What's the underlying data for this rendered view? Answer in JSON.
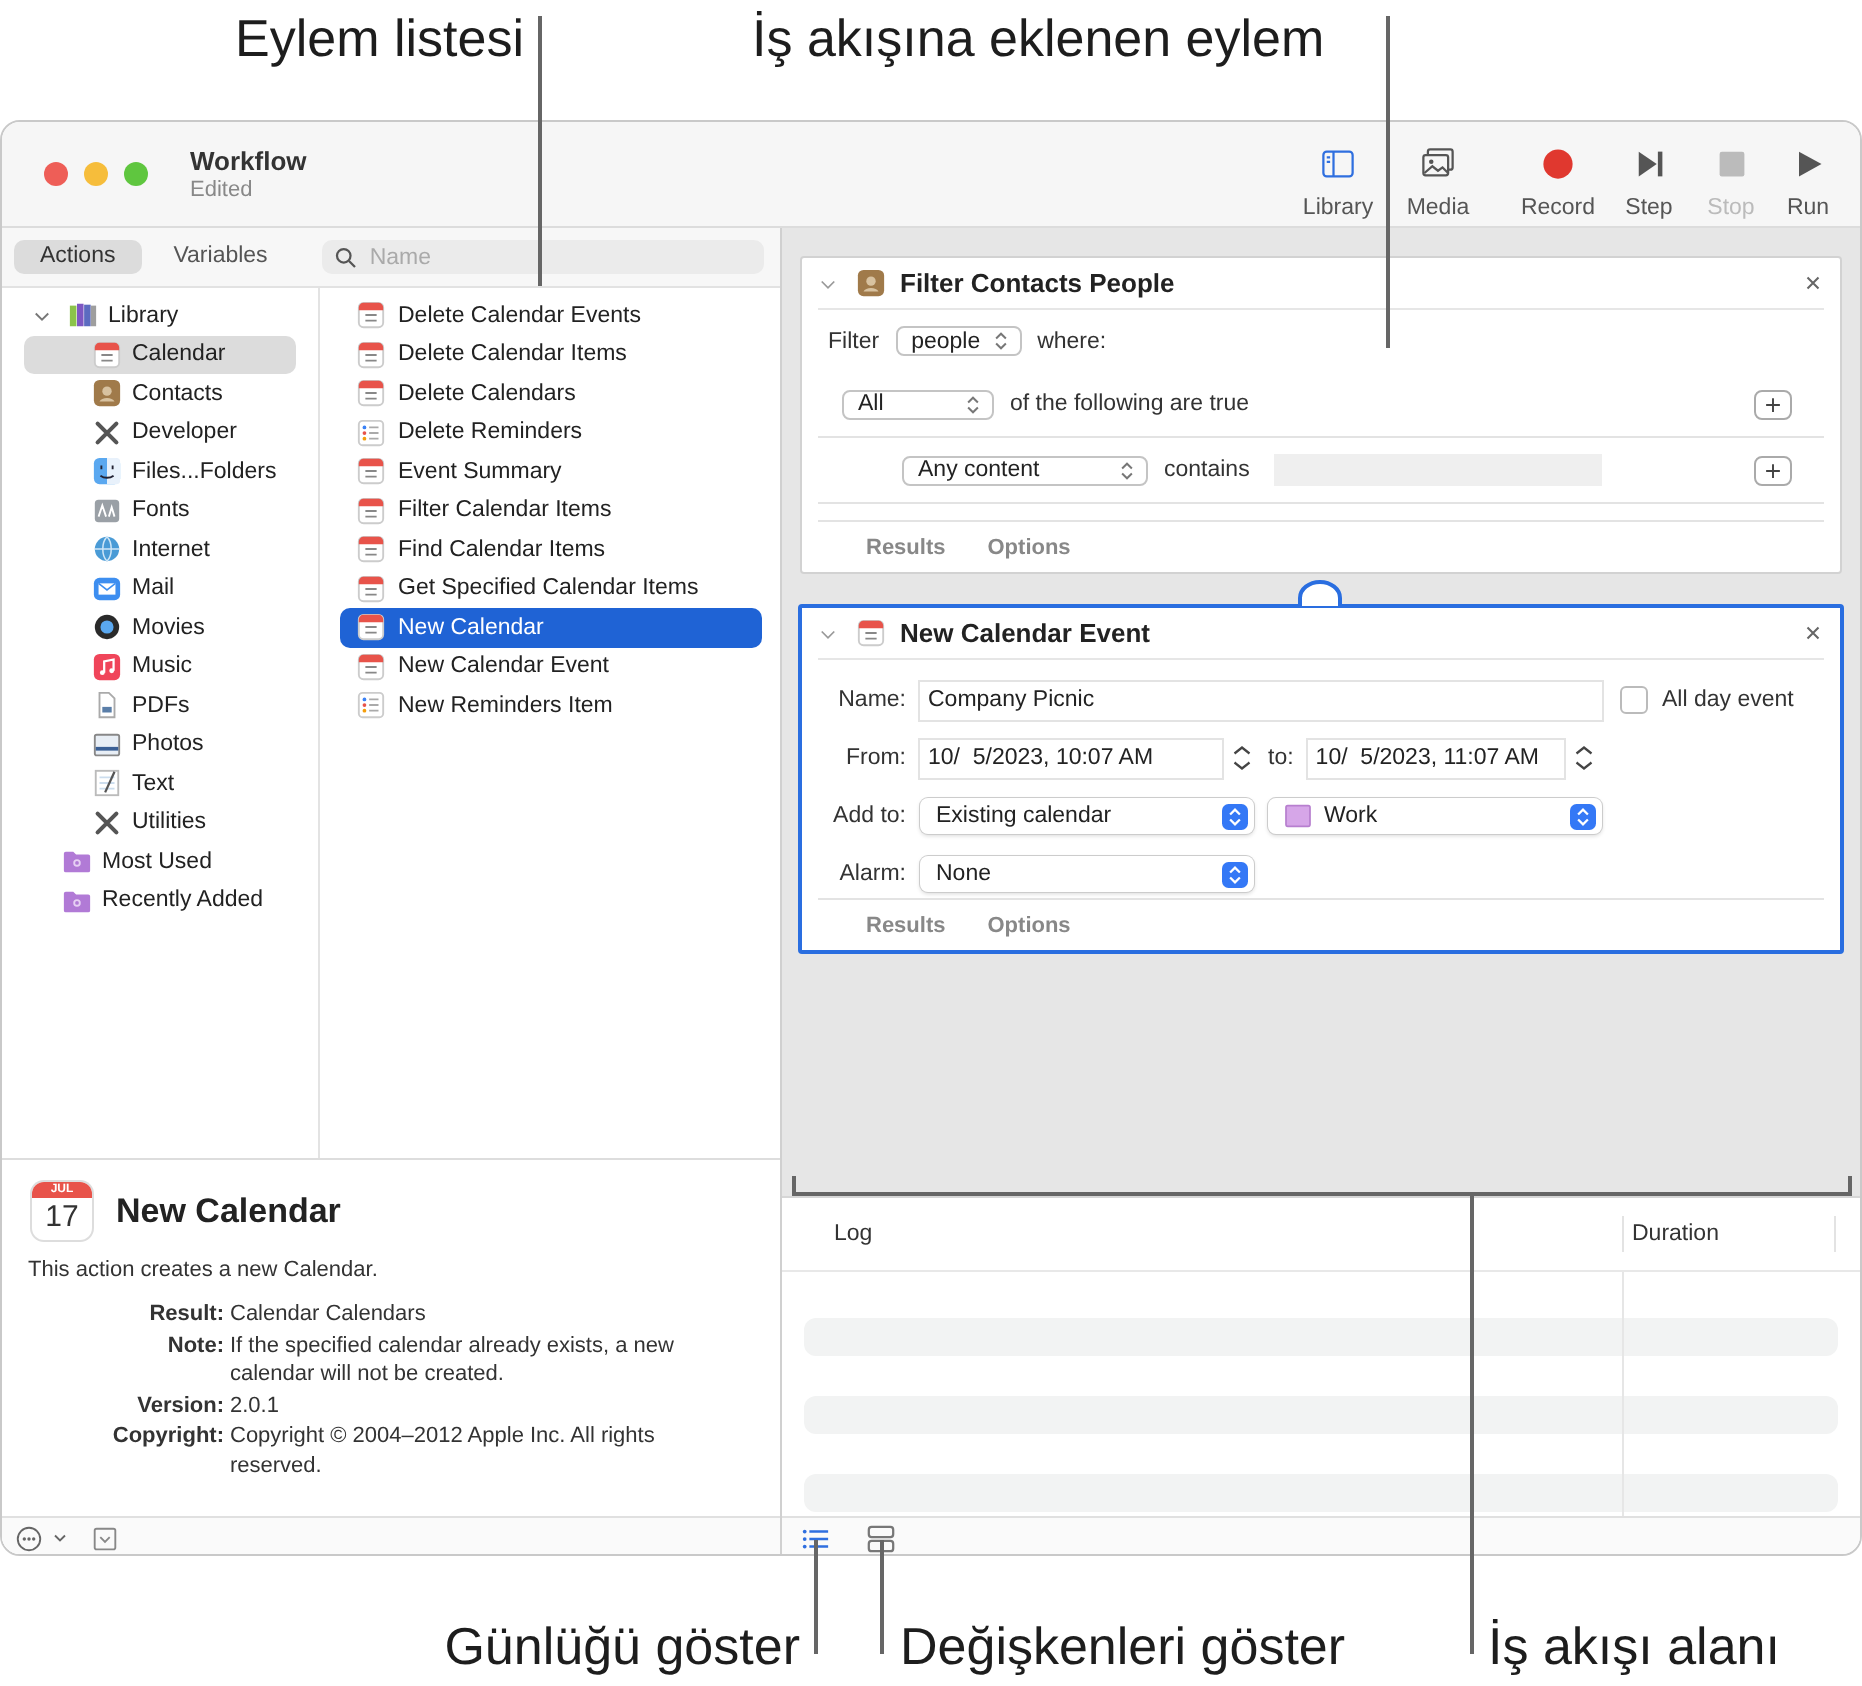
{
  "callouts": [
    {
      "text": "Eylem listesi"
    },
    {
      "text": "İş akışına eklenen eylem"
    },
    {
      "text": "Günlüğü göster"
    },
    {
      "text": "Değişkenleri göster"
    },
    {
      "text": "İş akışı alanı"
    }
  ],
  "window": {
    "title": "Workflow",
    "subtitle": "Edited"
  },
  "toolbar": [
    {
      "label": "Library",
      "kind": "library",
      "on": true,
      "disabled": false
    },
    {
      "label": "Media",
      "kind": "media",
      "on": false,
      "disabled": false
    },
    {
      "label": "Record",
      "kind": "record",
      "on": false,
      "disabled": false
    },
    {
      "label": "Step",
      "kind": "step",
      "on": false,
      "disabled": false
    },
    {
      "label": "Stop",
      "kind": "stop",
      "on": false,
      "disabled": true
    },
    {
      "label": "Run",
      "kind": "run",
      "on": false,
      "disabled": false
    }
  ],
  "library_tabs": [
    {
      "label": "Actions",
      "selected": true
    },
    {
      "label": "Variables",
      "selected": false
    }
  ],
  "search": {
    "placeholder": "Name"
  },
  "library_tree": [
    {
      "label": "Library",
      "kind": "library",
      "expanded": true,
      "selected": false,
      "children": [
        {
          "label": "Calendar",
          "kind": "calendar",
          "selected": true
        },
        {
          "label": "Contacts",
          "kind": "contacts",
          "selected": false
        },
        {
          "label": "Developer",
          "kind": "tools",
          "selected": false
        },
        {
          "label": "Files...Folders",
          "kind": "finder",
          "selected": false
        },
        {
          "label": "Fonts",
          "kind": "fonts",
          "selected": false
        },
        {
          "label": "Internet",
          "kind": "internet",
          "selected": false
        },
        {
          "label": "Mail",
          "kind": "mail",
          "selected": false
        },
        {
          "label": "Movies",
          "kind": "movies",
          "selected": false
        },
        {
          "label": "Music",
          "kind": "music",
          "selected": false
        },
        {
          "label": "PDFs",
          "kind": "pdfs",
          "selected": false
        },
        {
          "label": "Photos",
          "kind": "photos",
          "selected": false
        },
        {
          "label": "Text",
          "kind": "text",
          "selected": false
        },
        {
          "label": "Utilities",
          "kind": "tools",
          "selected": false
        }
      ]
    },
    {
      "label": "Most Used",
      "kind": "smart",
      "selected": false
    },
    {
      "label": "Recently Added",
      "kind": "smart",
      "selected": false
    }
  ],
  "actions": [
    {
      "label": "Delete Calendar Events",
      "kind": "calendar",
      "selected": false
    },
    {
      "label": "Delete Calendar Items",
      "kind": "calendar",
      "selected": false
    },
    {
      "label": "Delete Calendars",
      "kind": "calendar",
      "selected": false
    },
    {
      "label": "Delete Reminders",
      "kind": "reminders",
      "selected": false
    },
    {
      "label": "Event Summary",
      "kind": "calendar",
      "selected": false
    },
    {
      "label": "Filter Calendar Items",
      "kind": "calendar",
      "selected": false
    },
    {
      "label": "Find Calendar Items",
      "kind": "calendar",
      "selected": false
    },
    {
      "label": "Get Specified Calendar Items",
      "kind": "calendar",
      "selected": false
    },
    {
      "label": "New Calendar",
      "kind": "calendar",
      "selected": true
    },
    {
      "label": "New Calendar Event",
      "kind": "calendar",
      "selected": false
    },
    {
      "label": "New Reminders Item",
      "kind": "reminders",
      "selected": false
    }
  ],
  "description": {
    "title": "New Calendar",
    "icon_month": "JUL",
    "icon_day": "17",
    "summary": "This action creates a new Calendar.",
    "fields": [
      {
        "label": "Result:",
        "value": "Calendar Calendars"
      },
      {
        "label": "Note:",
        "value": "If the specified calendar already exists, a new calendar will not be created."
      },
      {
        "label": "Version:",
        "value": "2.0.1"
      },
      {
        "label": "Copyright:",
        "value": "Copyright © 2004–2012 Apple Inc.  All rights reserved."
      }
    ]
  },
  "workflow": {
    "actions": [
      {
        "kind": "filter",
        "title": "Filter Contacts People",
        "selected": false,
        "filter_label": "Filter",
        "filter_value": "people",
        "where": "where:",
        "match_value": "All",
        "match_text": "of the following are true",
        "condition_field": "Any content",
        "condition_op": "contains",
        "tabs": [
          "Results",
          "Options"
        ]
      },
      {
        "kind": "event",
        "title": "New Calendar Event",
        "selected": true,
        "name_label": "Name:",
        "name_value": "Company Picnic",
        "all_day_label": "All day event",
        "all_day": false,
        "from_label": "From:",
        "from_value": "10/  5/2023, 10:07 AM",
        "to_label": "to:",
        "to_value": "10/  5/2023, 11:07 AM",
        "add_to_label": "Add to:",
        "add_to_value": "Existing calendar",
        "calendar_value": "Work",
        "alarm_label": "Alarm:",
        "alarm_value": "None",
        "tabs": [
          "Results",
          "Options"
        ]
      }
    ]
  },
  "log": {
    "columns": [
      "Log",
      "Duration"
    ]
  },
  "bottom_buttons": [
    {
      "kind": "log",
      "selected": true
    },
    {
      "kind": "variables",
      "selected": false
    }
  ]
}
